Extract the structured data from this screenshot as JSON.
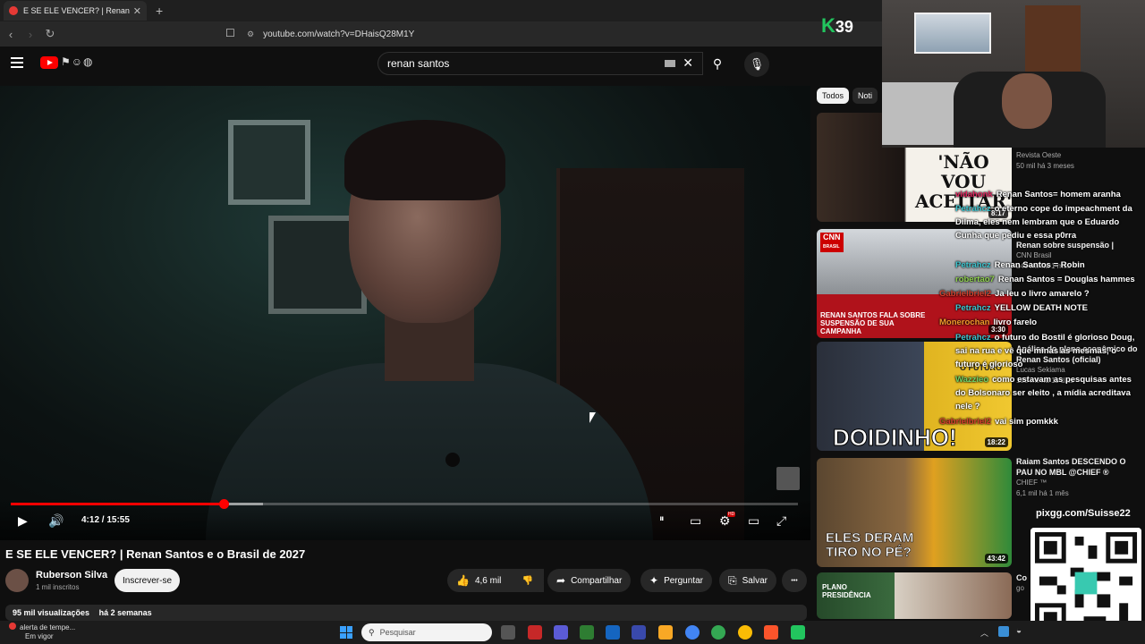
{
  "browser": {
    "tab_title": "E SE ELE VENCER? | Renan Santo",
    "tab_close": "✕",
    "new_tab": "+",
    "url": "youtube.com/watch?v=DHaisQ28M1Y"
  },
  "youtube": {
    "search_value": "renan santos",
    "search_clear": "✕"
  },
  "player": {
    "progress_fraction": 0.27,
    "buffered_fraction": 0.32,
    "time": "4:12 / 15:55"
  },
  "video": {
    "title": "E SE ELE VENCER? | Renan Santos e o Brasil de 2027",
    "channel": "Ruberson Silva",
    "subscribers": "1 mil inscritos",
    "subscribe_label": "Inscrever-se",
    "likes": "4,6 mil",
    "share_label": "Compartilhar",
    "ask_label": "Perguntar",
    "save_label": "Salvar",
    "more": "•••",
    "views": "95 mil visualizações",
    "age": "há 2 semanas"
  },
  "sidebar": {
    "chips": [
      "Todos",
      "Noti"
    ],
    "items": [
      {
        "caption": "'NÃO VOU ACEITAR'",
        "duration": "8:17",
        "channel": "Revista Oeste",
        "meta": "50 mil  há 3 meses"
      },
      {
        "caption": "RENAN SANTOS FALA SOBRE SUSPENSÃO DE SUA CAMPANHA",
        "badge": "CNN",
        "badge_sub": "BRASIL",
        "duration": "3:30",
        "title": "Renan sobre suspensão |",
        "channel": "CNN Brasil",
        "meta": "240 mil  há 1 mês"
      },
      {
        "caption": "DOIDINHO!",
        "overlay": "O FUTURO",
        "duration": "18:22",
        "title": "Análise do plano econômico do Renan Santos (oficial)",
        "channel": "Lucas Sekiama",
        "meta": "188 mil  há 11 dias"
      },
      {
        "caption": "ELES DERAM TIRO NO PÉ?",
        "duration": "43:42",
        "title": "Raiam Santos DESCENDO O PAU NO MBL @CHIEF ®",
        "channel": "CHIEF ™",
        "meta": "6,1 mil  há 1 mês"
      },
      {
        "caption": "PLANO PRESIDÊNCIA",
        "title": "Co",
        "channel": "go"
      }
    ]
  },
  "stream": {
    "badge_letter": "K",
    "badge_number": "39",
    "pix_url": "pixgg.com/Suisse22"
  },
  "chat": [
    {
      "user": "vidahonk",
      "color": "#e0245e",
      "msg": "Renan Santos= homem aranha"
    },
    {
      "user": "Petrahcz",
      "color": "#3ec6d0",
      "msg": "o eterno cope do impeachment da Dilma, eles nem lembram que o Eduardo Cunha que pediu e essa p0rra"
    },
    {
      "user": "Petrahcz",
      "color": "#3ec6d0",
      "msg": "Renan Santos = Robin"
    },
    {
      "user": "robertao7",
      "color": "#8fd14f",
      "msg": "Renan Santos = Douglas hammes"
    },
    {
      "user": "Gabrielbriel2",
      "color": "#d6402e",
      "msg": "Ja leu o livro amarelo ?"
    },
    {
      "user": "Petrahcz",
      "color": "#3ec6d0",
      "msg": "YELLOW DEATH NOTE"
    },
    {
      "user": "Monerochan",
      "color": "#f29b2c",
      "msg": "livro farelo"
    },
    {
      "user": "Petrahcz",
      "color": "#3ec6d0",
      "msg": "o futuro do Bostil é glorioso Doug, sai na rua e vê que minas as mesmas, o futuro é glorioso"
    },
    {
      "user": "Wazzieo",
      "color": "#6fd26a",
      "msg": "como estavam as pesquisas antes do Bolsonaro ser eleito , a mídia acreditava nele ?"
    },
    {
      "user": "Gabrielbriel2",
      "color": "#d6402e",
      "msg": "vai sim pomkkk"
    }
  ],
  "taskbar": {
    "weather_line1": "alerta de tempe...",
    "weather_line2": "Em vigor",
    "search_placeholder": "Pesquisar"
  },
  "colors": {
    "accent": "#ff0000",
    "background": "#0f0f0f",
    "pill": "#272727"
  }
}
